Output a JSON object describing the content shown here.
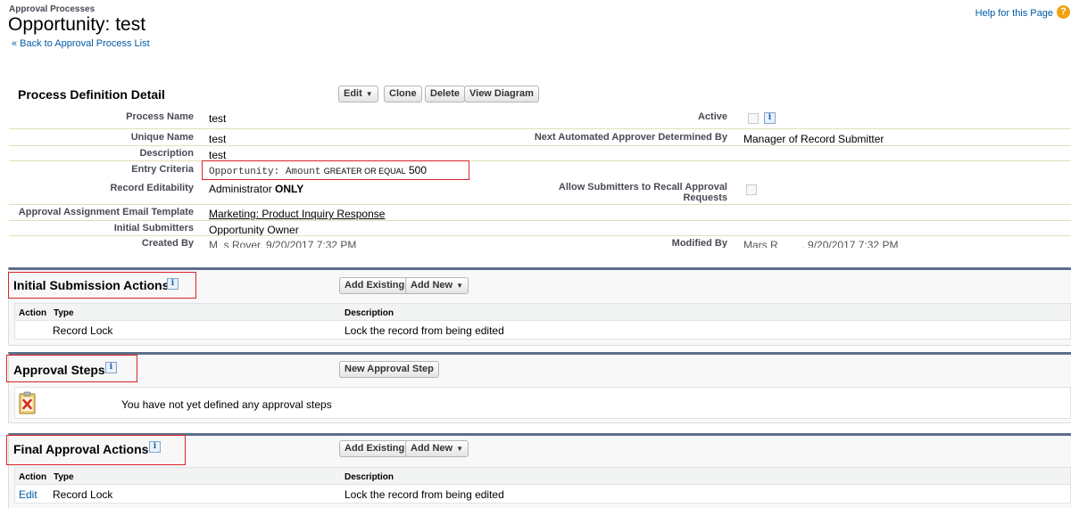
{
  "header": {
    "breadcrumb": "Approval Processes",
    "title": "Opportunity: test",
    "back_link": "Back to Approval Process List",
    "back_arrow": "«",
    "help_link": "Help for this Page",
    "help_icon": "question-icon"
  },
  "detail": {
    "title": "Process Definition Detail",
    "buttons": {
      "edit": "Edit",
      "clone": "Clone",
      "delete": "Delete",
      "view_diagram": "View Diagram"
    },
    "fields": {
      "process_name_label": "Process Name",
      "process_name_value": "test",
      "active_label": "Active",
      "unique_name_label": "Unique Name",
      "unique_name_value": "test",
      "next_approver_label": "Next Automated Approver Determined By",
      "next_approver_value": "Manager of Record Submitter",
      "description_label": "Description",
      "description_value": "test",
      "entry_criteria_label": "Entry Criteria",
      "entry_criteria_field": "Opportunity: Amount",
      "entry_criteria_operator": "GREATER OR EQUAL",
      "entry_criteria_value": "500",
      "record_editability_label": "Record Editability",
      "record_editability_value_prefix": "Administrator",
      "record_editability_value_strong": "ONLY",
      "allow_recall_label_line1": "Allow Submitters to Recall Approval",
      "allow_recall_label_line2": "Requests",
      "email_template_label": "Approval Assignment Email Template",
      "email_template_value": "Marketing: Product Inquiry Response",
      "initial_submitters_label": "Initial Submitters",
      "initial_submitters_value": "Opportunity Owner",
      "created_by_label": "Created By",
      "created_by_value": "M_s Rover, 9/20/2017 7:32 PM",
      "modified_by_label": "Modified By",
      "modified_by_value": "Mars R____, 9/20/2017 7:32 PM"
    }
  },
  "initial_submission": {
    "title": "Initial Submission Actions",
    "buttons": {
      "add_existing": "Add Existing",
      "add_new": "Add New"
    },
    "columns": {
      "action": "Action",
      "type": "Type",
      "description": "Description"
    },
    "rows": [
      {
        "action": "",
        "type": "Record Lock",
        "description": "Lock the record from being edited"
      }
    ]
  },
  "approval_steps": {
    "title": "Approval Steps",
    "button": "New Approval Step",
    "empty_message": "You have not yet defined any approval steps",
    "empty_icon": "clipboard-x-icon"
  },
  "final_approval": {
    "title": "Final Approval Actions",
    "buttons": {
      "add_existing": "Add Existing",
      "add_new": "Add New"
    },
    "columns": {
      "action": "Action",
      "type": "Type",
      "description": "Description"
    },
    "rows": [
      {
        "action": "Edit",
        "type": "Record Lock",
        "description": "Lock the record from being edited"
      }
    ]
  },
  "colors": {
    "link": "#015ba7",
    "section_border": "#5e6e8a",
    "highlight_box": "#d9242a",
    "help_icon": "#f2a10e"
  }
}
